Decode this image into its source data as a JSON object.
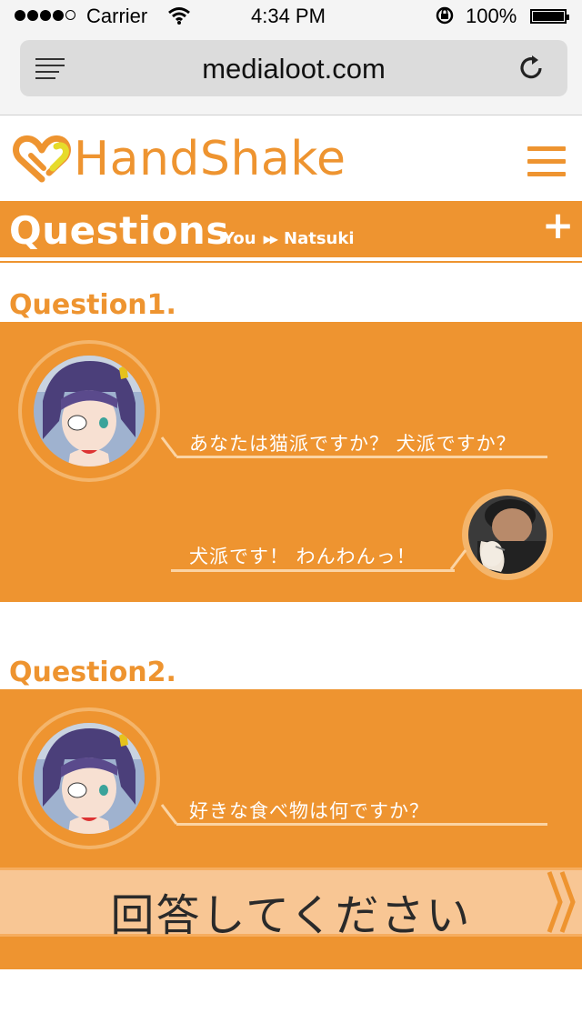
{
  "status_bar": {
    "carrier": "Carrier",
    "time": "4:34 PM",
    "battery": "100%",
    "signal_bars": 4
  },
  "browser": {
    "url": "medialoot.com"
  },
  "header": {
    "logo_text": "HandShake",
    "accent_color": "#ee9430"
  },
  "section": {
    "title": "Questions",
    "from": "You",
    "to": "Natsuki",
    "add_label": "+"
  },
  "questions": [
    {
      "heading": "Question1.",
      "question": "あなたは猫派ですか？ 犬派ですか？",
      "answer": "犬派です！ わんわんっ！"
    },
    {
      "heading": "Question2.",
      "question": "好きな食べ物は何ですか？",
      "answer_prompt": "回答してください"
    }
  ]
}
